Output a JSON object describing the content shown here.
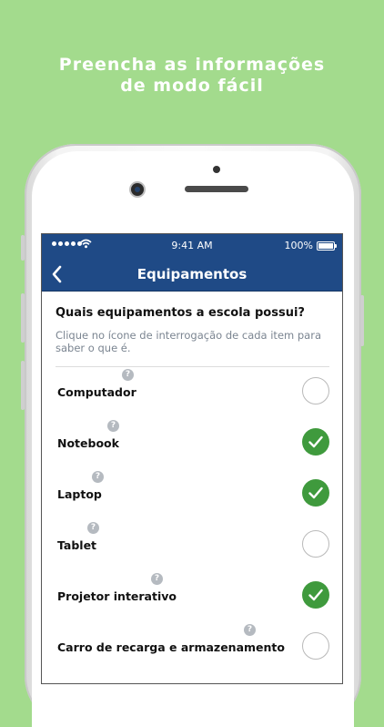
{
  "promo": {
    "line1": "Preencha as informações",
    "line2": "de modo fácil"
  },
  "colors": {
    "background": "#a3db8d",
    "nav_bar": "#1f4a86",
    "checked": "#3f9a3d",
    "help_badge": "#b5bac0"
  },
  "status_bar": {
    "time": "9:41 AM",
    "battery": "100%"
  },
  "nav": {
    "title": "Equipamentos",
    "back_icon": "chevron-left-icon"
  },
  "form": {
    "question": "Quais equipamentos a escola possui?",
    "hint": "Clique no ícone de interrogação de cada item para saber o que é.",
    "help_symbol": "?",
    "items": [
      {
        "label": "Computador",
        "checked": false
      },
      {
        "label": "Notebook",
        "checked": true
      },
      {
        "label": "Laptop",
        "checked": true
      },
      {
        "label": "Tablet",
        "checked": false
      },
      {
        "label": "Projetor interativo",
        "checked": true
      },
      {
        "label": "Carro de recarga e armazenamento",
        "checked": false
      }
    ]
  }
}
